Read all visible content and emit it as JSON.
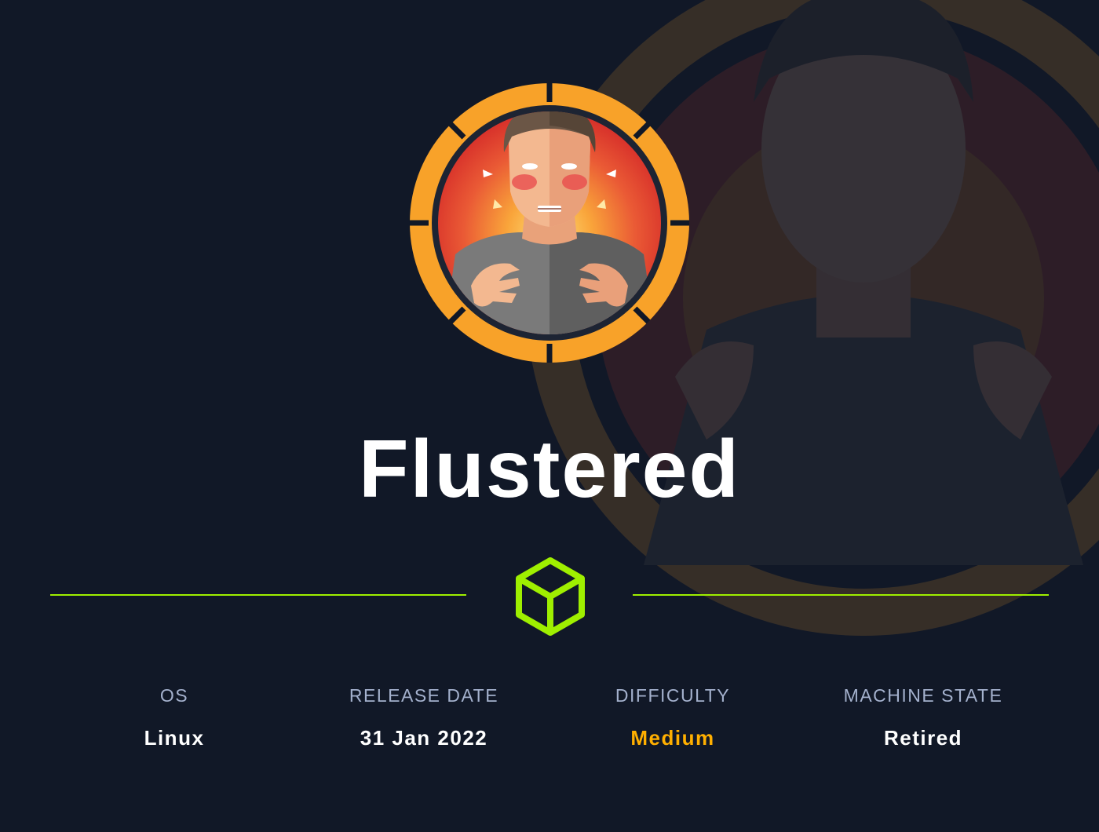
{
  "machine": {
    "name": "Flustered"
  },
  "stats": [
    {
      "label": "OS",
      "value": "Linux"
    },
    {
      "label": "RELEASE DATE",
      "value": "31 Jan 2022"
    },
    {
      "label": "DIFFICULTY",
      "value": "Medium"
    },
    {
      "label": "MACHINE STATE",
      "value": "Retired"
    }
  ],
  "colors": {
    "background": "#111827",
    "accent_green": "#9fef00",
    "difficulty_medium": "#ffaf00",
    "label_gray": "#a4b1cd",
    "avatar_ring": "#f8a229"
  },
  "icons": {
    "machine_avatar": "flustered-avatar",
    "divider_icon": "cube-icon"
  }
}
